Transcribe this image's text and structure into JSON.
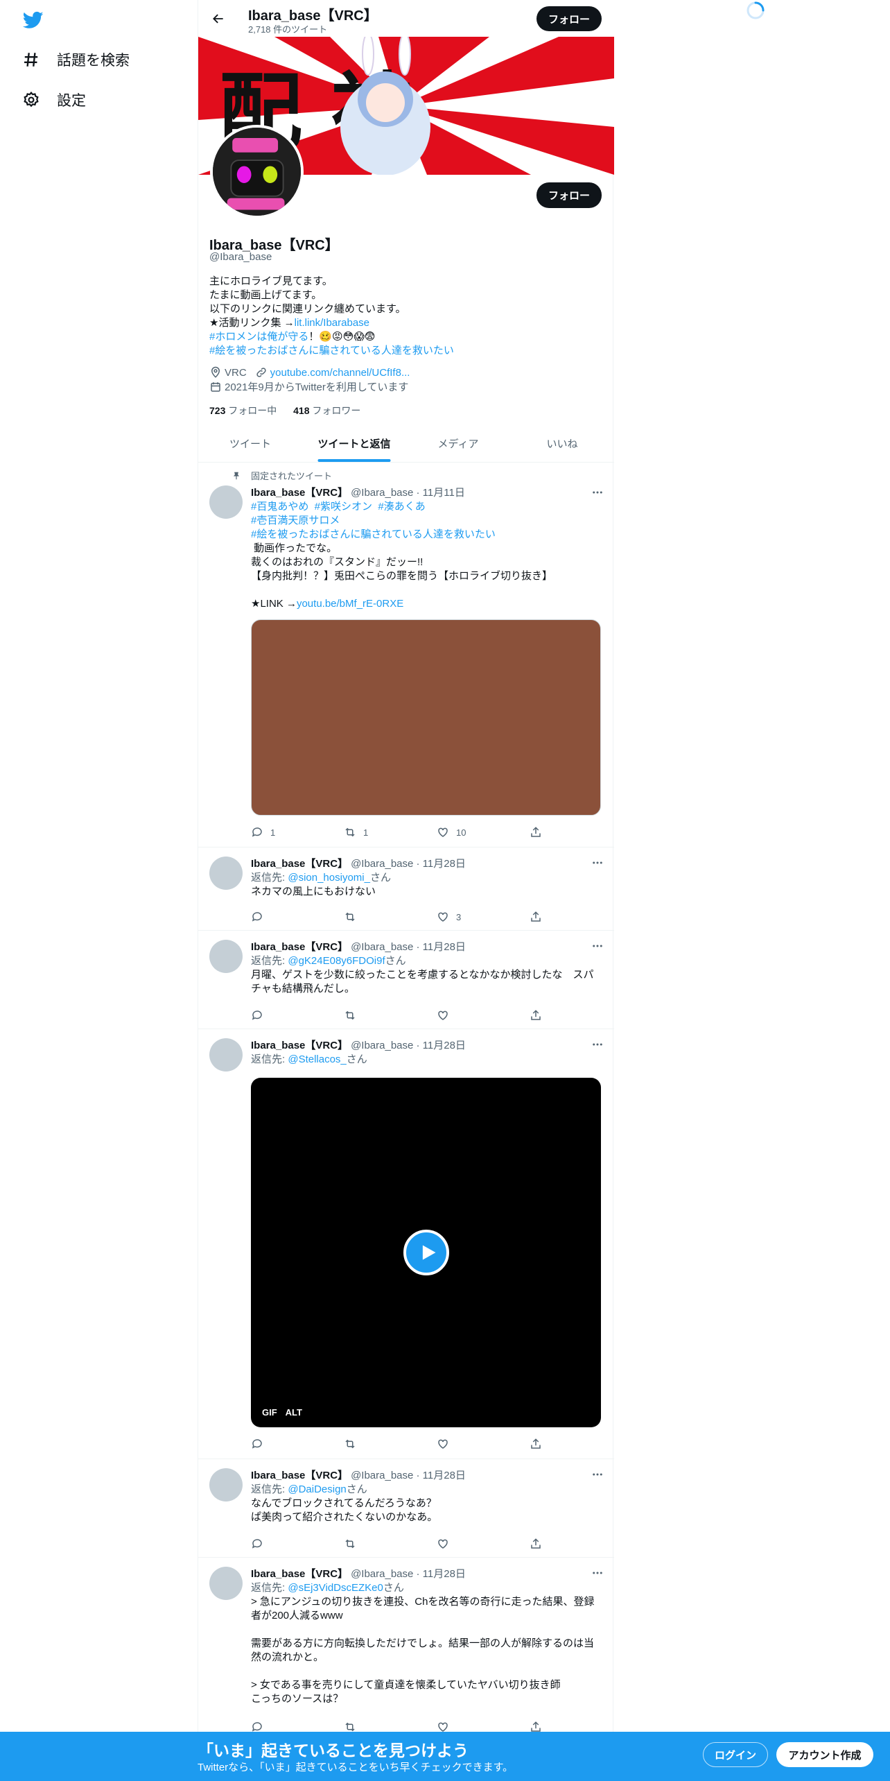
{
  "sidebar": {
    "items": [
      {
        "label": "話題を検索",
        "icon": "hashtag-icon"
      },
      {
        "label": "設定",
        "icon": "gear-icon"
      }
    ]
  },
  "header": {
    "title": "Ibara_base【VRC】",
    "tweet_count": "2,718 件のツイート",
    "follow_label": "フォロー"
  },
  "banner": {
    "text": "配 神",
    "accent": "#e10d1c"
  },
  "profile": {
    "display_name": "Ibara_base【VRC】",
    "handle": "@Ibara_base",
    "follow_label": "フォロー",
    "bio": {
      "line1": "主にホロライブ見てます。",
      "line2": "たまに動画上げてます。",
      "line3": "以下のリンクに関連リンク纏めています。",
      "line4_prefix": "★活動リンク集 →",
      "line4_link": "lit.link/Ibarabase",
      "line5_link": "#ホロメンは俺が守る",
      "line5_suffix": "！🥴😡😳😱😨",
      "line6_link": "#絵を被ったおばさんに騙されている人達を救いたい"
    },
    "location": "VRC",
    "website": "youtube.com/channel/UCfIf8...",
    "joined": "2021年9月からTwitterを利用しています",
    "following_count": "723",
    "following_label": "フォロー中",
    "followers_count": "418",
    "followers_label": "フォロワー"
  },
  "tabs": [
    {
      "label": "ツイート",
      "active": false
    },
    {
      "label": "ツイートと返信",
      "active": true
    },
    {
      "label": "メディア",
      "active": false
    },
    {
      "label": "いいね",
      "active": false
    }
  ],
  "tweets": [
    {
      "pinned_label": "固定されたツイート",
      "name": "Ibara_base【VRC】",
      "meta": "@Ibara_base · 11月11日",
      "hashtags1": "#百鬼あやめ  #紫咲シオン  #湊あくあ",
      "hashtags2": "#壱百満天原サロメ",
      "hashtags3": "#絵を被ったおばさんに騙されている人達を救いたい",
      "line1": " 動画作ったでな。",
      "line2": "裁くのはおれの『スタンド』だッー!!",
      "line3": "【身内批判！？】兎田ぺこらの罪を問う【ホロライブ切り抜き】",
      "link_prefix": "★LINK →",
      "link": "youtu.be/bMf_rE-0RXE",
      "replies": "1",
      "retweets": "1",
      "likes": "10"
    },
    {
      "name": "Ibara_base【VRC】",
      "meta": "@Ibara_base · 11月28日",
      "reply_prefix": "返信先: ",
      "reply_to": "@sion_hosiyomi_",
      "reply_suffix": "さん",
      "text1": "ネカマの風上にもおけない",
      "likes": "3"
    },
    {
      "name": "Ibara_base【VRC】",
      "meta": "@Ibara_base · 11月28日",
      "reply_prefix": "返信先: ",
      "reply_to": "@gK24E08y6FDOi9f",
      "reply_suffix": "さん",
      "text1": "月曜、ゲストを少数に絞ったことを考慮するとなかなか検討したな　スパ",
      "text2": "チャも結構飛んだし。"
    },
    {
      "name": "Ibara_base【VRC】",
      "meta": "@Ibara_base · 11月28日",
      "reply_prefix": "返信先: ",
      "reply_to": "@Stellacos_",
      "reply_suffix": "さん",
      "gif_label": "GIF",
      "alt_label": "ALT"
    },
    {
      "name": "Ibara_base【VRC】",
      "meta": "@Ibara_base · 11月28日",
      "reply_prefix": "返信先: ",
      "reply_to": "@DaiDesign",
      "reply_suffix": "さん",
      "text1": "なんでブロックされてるんだろうなあ？",
      "text2": "ぱ美肉って紹介されたくないのかなあ。"
    },
    {
      "name": "Ibara_base【VRC】",
      "meta": "@Ibara_base · 11月28日",
      "reply_prefix": "返信先: ",
      "reply_to": "@sEj3VidDscEZKe0",
      "reply_suffix": "さん",
      "text1": "> 急にアンジュの切り抜きを連投、Chを改名等の奇行に走った結果、登録",
      "text2": "者が200人減るwww",
      "text3": "需要がある方に方向転換しただけでしょ。結果一部の人が解除するのは当",
      "text4": "然の流れかと。",
      "text5": "> 女である事を売りにして童貞達を懐柔していたヤバい切り抜き師",
      "text6": "こっちのソースは？"
    }
  ],
  "bottom_bar": {
    "title": "「いま」起きていることを見つけよう",
    "subtitle": "Twitterなら、「いま」起きていることをいち早くチェックできます。",
    "login_label": "ログイン",
    "signup_label": "アカウント作成"
  },
  "colors": {
    "accent": "#1d9bf0",
    "text": "#0f1419",
    "muted": "#536471"
  }
}
